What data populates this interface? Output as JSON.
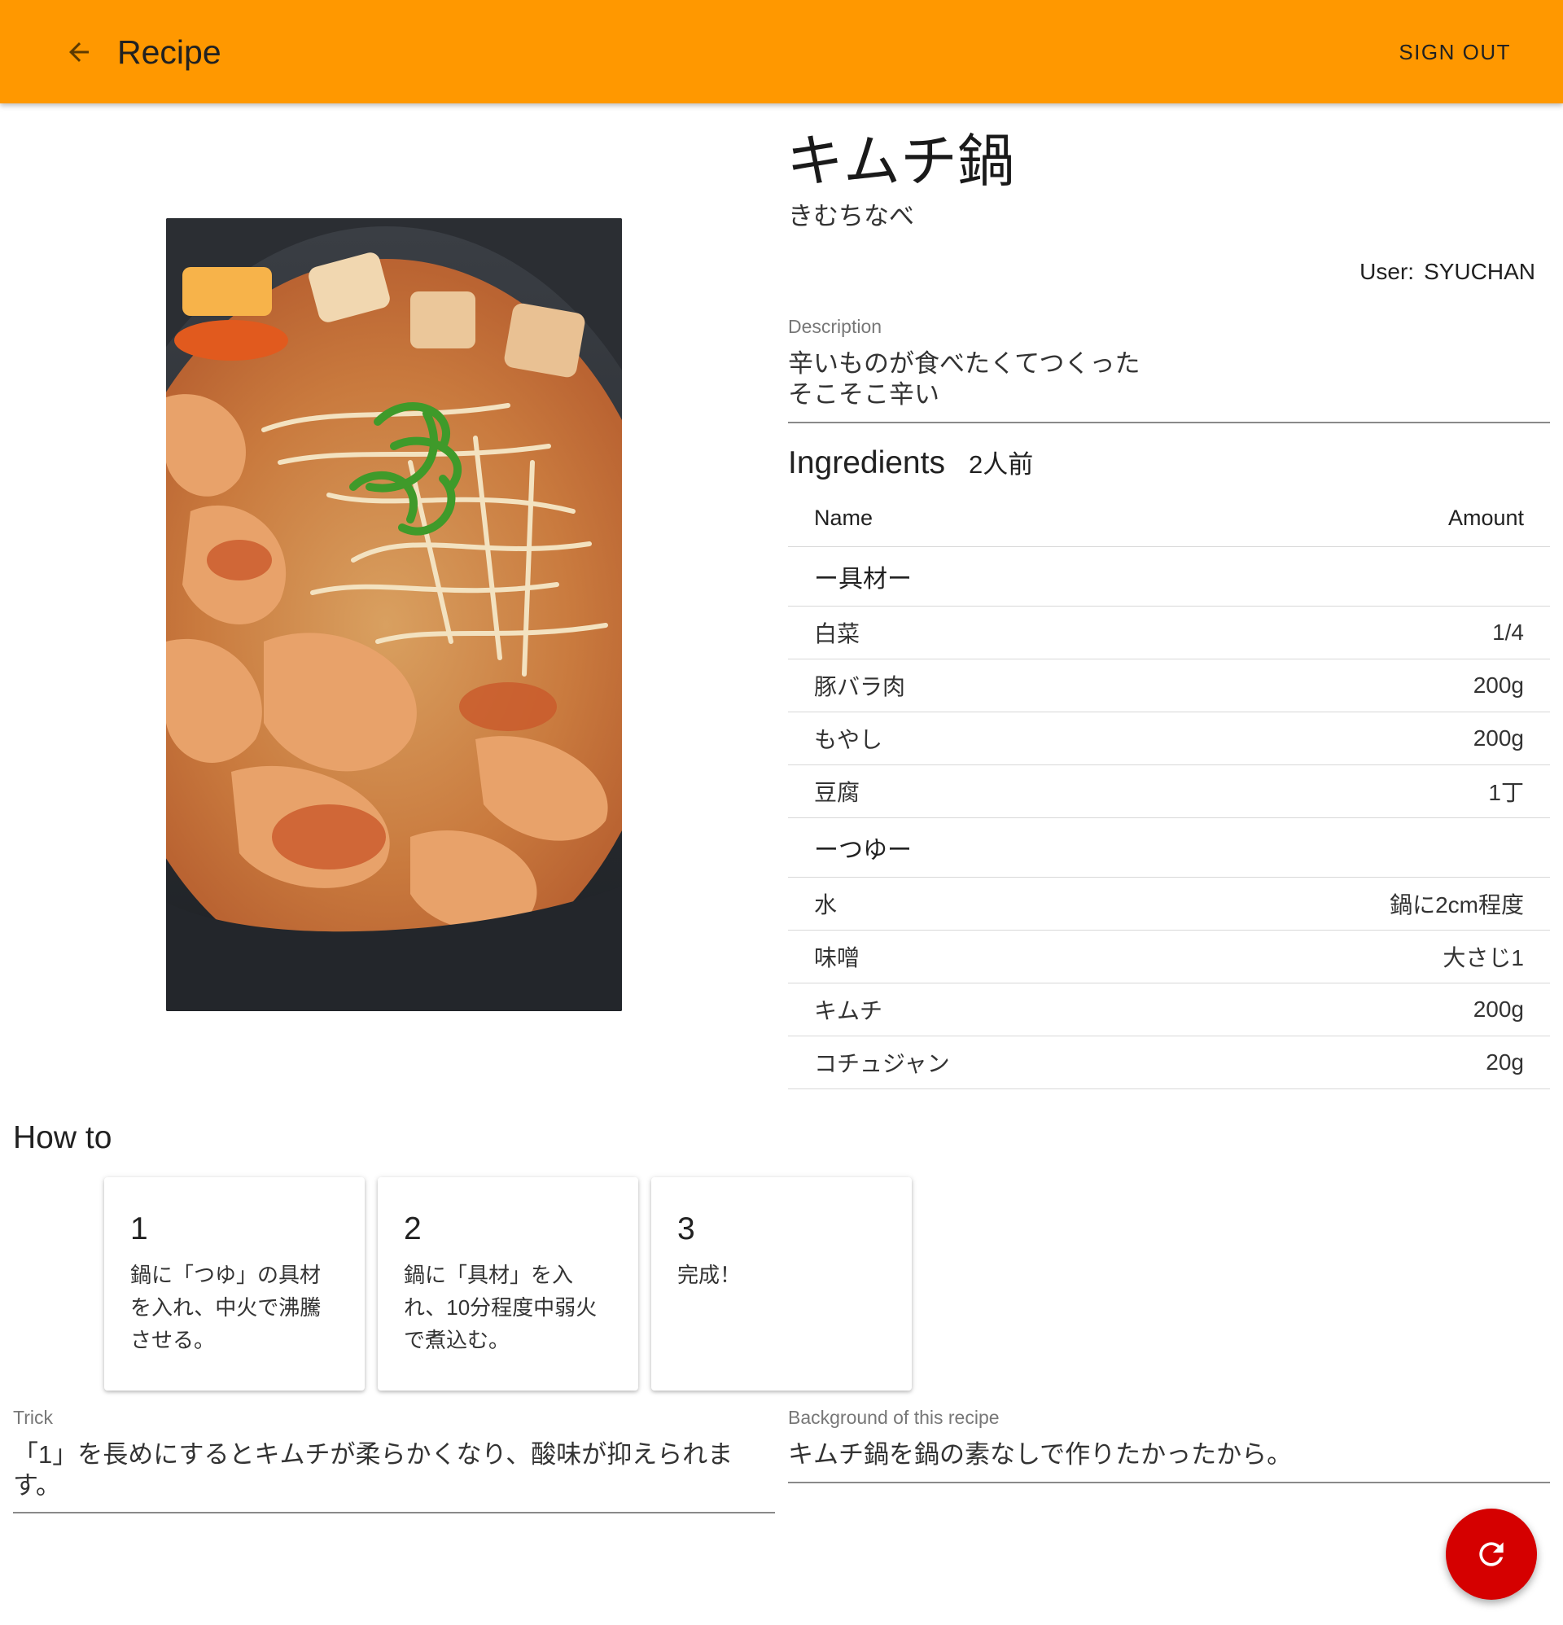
{
  "appbar": {
    "title": "Recipe",
    "back_icon": "arrow-left-icon",
    "signout_label": "SIGN OUT",
    "background": "#ff9800"
  },
  "recipe": {
    "title": "キムチ鍋",
    "kana": "きむちなべ",
    "user_label": "User:",
    "user_name": "SYUCHAN",
    "description_label": "Description",
    "description": "辛いものが食べたくてつくった\nそこそこ辛い",
    "photo_alt": "kimchi hot pot photo"
  },
  "ingredients": {
    "heading": "Ingredients",
    "servings": "2人前",
    "col_name": "Name",
    "col_amount": "Amount",
    "rows": [
      {
        "type": "section",
        "name": "ー具材ー",
        "amount": ""
      },
      {
        "type": "item",
        "name": "白菜",
        "amount": "1/4"
      },
      {
        "type": "item",
        "name": "豚バラ肉",
        "amount": "200g"
      },
      {
        "type": "item",
        "name": "もやし",
        "amount": "200g"
      },
      {
        "type": "item",
        "name": "豆腐",
        "amount": "1丁"
      },
      {
        "type": "section",
        "name": "ーつゆー",
        "amount": ""
      },
      {
        "type": "item",
        "name": "水",
        "amount": "鍋に2cm程度"
      },
      {
        "type": "item",
        "name": "味噌",
        "amount": "大さじ1"
      },
      {
        "type": "item",
        "name": "キムチ",
        "amount": "200g"
      },
      {
        "type": "item",
        "name": "コチュジャン",
        "amount": "20g"
      }
    ]
  },
  "howto": {
    "heading": "How to",
    "steps": [
      {
        "num": "1",
        "text": "鍋に「つゆ」の具材を入れ、中火で沸騰させる。"
      },
      {
        "num": "2",
        "text": "鍋に「具材」を入れ、10分程度中弱火で煮込む。"
      },
      {
        "num": "3",
        "text": "完成！"
      }
    ]
  },
  "trick": {
    "label": "Trick",
    "value": "「1」を長めにするとキムチが柔らかくなり、酸味が抑えられます。"
  },
  "background": {
    "label": "Background of this recipe",
    "value": "キムチ鍋を鍋の素なしで作りたかったから。"
  },
  "fab": {
    "icon": "refresh-icon",
    "color": "#d50000"
  }
}
